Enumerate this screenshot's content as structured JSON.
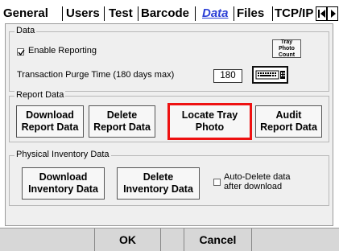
{
  "tabs": [
    {
      "label": "General"
    },
    {
      "label": "Users"
    },
    {
      "label": "Test"
    },
    {
      "label": "Barcode"
    },
    {
      "label": "Data"
    },
    {
      "label": "Files"
    },
    {
      "label": "TCP/IP"
    }
  ],
  "data_section": {
    "title": "Data",
    "enable_reporting_label": "Enable Reporting",
    "enable_reporting_checked": true,
    "tray_photo_count_line1": "Tray Photo",
    "tray_photo_count_line2": "Count",
    "purge_label": "Transaction Purge Time (180 days max)",
    "purge_value": "180"
  },
  "report_data": {
    "title": "Report Data",
    "download_line1": "Download",
    "download_line2": "Report Data",
    "delete_line1": "Delete",
    "delete_line2": "Report Data",
    "locate_line1": "Locate Tray",
    "locate_line2": "Photo",
    "audit_line1": "Audit",
    "audit_line2": "Report Data"
  },
  "inventory": {
    "title": "Physical Inventory Data",
    "download_line1": "Download",
    "download_line2": "Inventory Data",
    "delete_line1": "Delete",
    "delete_line2": "Inventory Data",
    "auto_delete_line1": "Auto-Delete data",
    "auto_delete_line2": "after download",
    "auto_delete_checked": false
  },
  "footer": {
    "ok_label": "OK",
    "cancel_label": "Cancel"
  },
  "colors": {
    "active_tab": "#2b3fd6",
    "highlight": "#ee1111"
  }
}
